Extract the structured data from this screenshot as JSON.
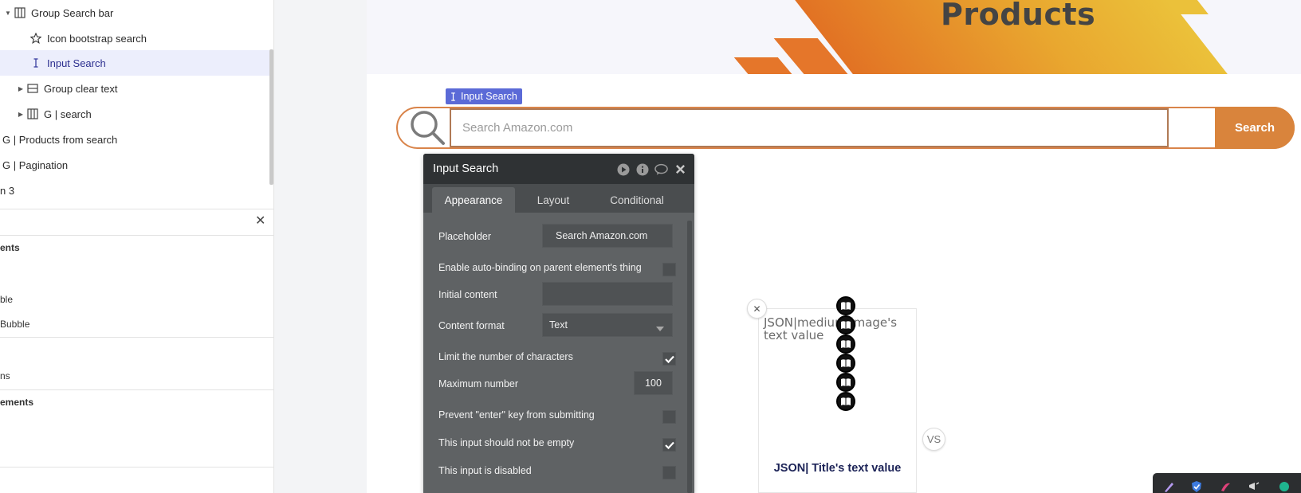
{
  "tree": {
    "items": [
      {
        "label": "Group Search bar",
        "icon": "columns-icon",
        "caret": "expanded"
      },
      {
        "label": "Icon bootstrap search",
        "icon": "star-icon"
      },
      {
        "label": "Input Search",
        "icon": "text-cursor-icon",
        "selected": true
      },
      {
        "label": "Group clear text",
        "icon": "rows-icon",
        "caret": "collapsed"
      },
      {
        "label": "G | search",
        "icon": "columns-icon",
        "caret": "collapsed"
      },
      {
        "label": "G | Products from search"
      },
      {
        "label": "G | Pagination"
      },
      {
        "label": "n 3"
      }
    ]
  },
  "side": {
    "section1": "ents",
    "item1": "ble",
    "item2": "Bubble",
    "item3": "ns",
    "section2": "ements",
    "close_glyph": "✕"
  },
  "canvas": {
    "hero_title": "Products",
    "input_tag": "Input Search",
    "search": {
      "placeholder": "Search Amazon.com",
      "button_label": "Search"
    }
  },
  "editor": {
    "title": "Input Search",
    "tabs": [
      "Appearance",
      "Layout",
      "Conditional"
    ],
    "active_tab": "Appearance",
    "placeholder_label": "Placeholder",
    "placeholder_value": "Search Amazon.com",
    "auto_binding_label": "Enable auto-binding on parent element's thing",
    "initial_content_label": "Initial content",
    "initial_content_value": "",
    "content_format_label": "Content format",
    "content_format_value": "Text",
    "limit_chars_label": "Limit the number of characters",
    "limit_chars_checked": true,
    "max_number_label": "Maximum number",
    "max_number_value": "100",
    "prevent_enter_label": "Prevent \"enter\" key from submitting",
    "prevent_enter_checked": false,
    "not_empty_label": "This input should not be empty",
    "not_empty_checked": true,
    "disabled_label": "This input is disabled",
    "disabled_checked": false
  },
  "card": {
    "image_text": "JSON|medium image's text value",
    "title": "JSON| Title's text value",
    "close_glyph": "✕",
    "vs_label": "VS",
    "book_icon_count": 6
  },
  "colors": {
    "accent": "#d9843c",
    "selection": "#5b6ad7",
    "editor_bg": "#5f6264",
    "editor_header": "#2f3234",
    "card_title": "#1c2357"
  }
}
